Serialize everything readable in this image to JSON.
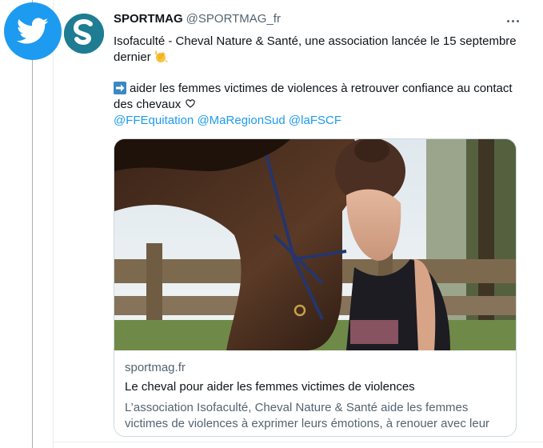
{
  "badge": {
    "icon": "twitter-bird-icon",
    "color": "#1d9bf0"
  },
  "author": {
    "display_name": "SPORTMAG",
    "handle": "@SPORTMAG_fr",
    "avatar_letter": "S",
    "avatar_color": "#1e7c93"
  },
  "tweet": {
    "line1": "Isofaculté - Cheval Nature & Santé, une association lancée le 15 septembre dernier",
    "line1_emoji": "clapping-hands-icon",
    "line2_emoji": "right-arrow-icon",
    "line2": "aider les femmes victimes de violences à retrouver confiance au contact des chevaux",
    "line2_trailing_icon": "heart-icon",
    "mentions": [
      "@FFEquitation",
      "@MaRegionSud",
      "@laFSCF"
    ]
  },
  "link_card": {
    "domain": "sportmag.fr",
    "title": "Le cheval pour aider les femmes victimes de violences",
    "description": "L’association Isofaculté, Cheval Nature & Santé aide les femmes victimes de violences à exprimer leurs émotions, à renouer avec leur"
  },
  "colors": {
    "link": "#1d9bf0",
    "secondary_text": "#536471",
    "border": "#cfd9de"
  }
}
